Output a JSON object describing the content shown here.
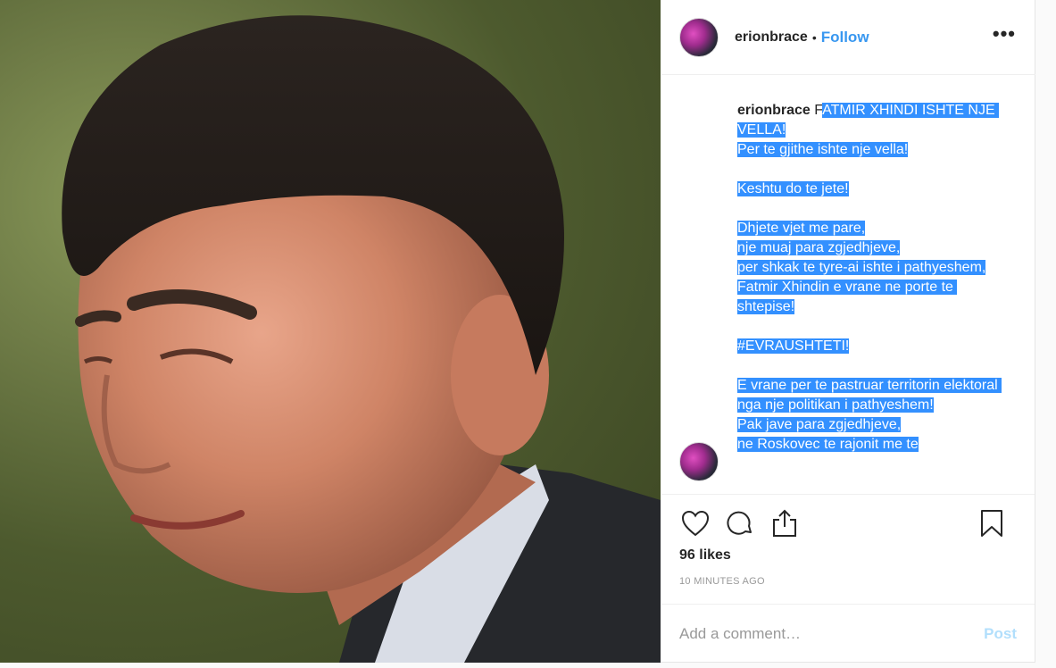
{
  "header": {
    "username": "erionbrace",
    "separator": "•",
    "follow_label": "Follow",
    "more_icon": "more-options-icon",
    "more_glyph": "•••"
  },
  "caption": {
    "username": "erionbrace",
    "first_letter": "F",
    "selected_text": "ATMIR XHINDI ISHTE NJE VELLA!\nPer te gjithe ishte nje vella!\n\nKeshtu do te jete!\n\nDhjete vjet me pare,\nnje muaj para zgjedhjeve,\nper shkak te tyre-ai ishte i pathyeshem,\nFatmir Xhindin e vrane ne porte te shtepise!\n\n#EVRAUSHTETI!\n\nE vrane per te pastruar territorin elektoral nga nje politikan i pathyeshem!\nPak jave para zgjedhjeve,\nne Roskovec te rajonit me te"
  },
  "actions": {
    "like_icon": "heart-icon",
    "comment_icon": "comment-icon",
    "share_icon": "share-icon",
    "save_icon": "bookmark-icon"
  },
  "likes": "96 likes",
  "timestamp": "10 MINUTES AGO",
  "comment": {
    "placeholder": "Add a comment…",
    "value": "",
    "post_label": "Post"
  },
  "colors": {
    "accent": "#3897f0",
    "selection": "#3390ff",
    "post_disabled": "#b2dffc"
  }
}
